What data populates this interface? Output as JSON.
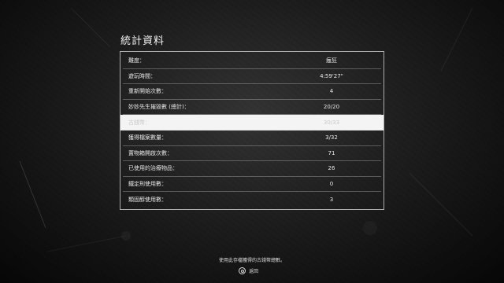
{
  "title": "統計資料",
  "stats": [
    {
      "label": "難度：",
      "value": "瘋狂"
    },
    {
      "label": "遊玩時間：",
      "value": "4:59'27\""
    },
    {
      "label": "重新開始次數：",
      "value": "4"
    },
    {
      "label": "妙妙先生摧毀數 (總計)：",
      "value": "20/20"
    },
    {
      "label": "古錢幣：",
      "value": "30/33"
    },
    {
      "label": "獲得檔案數量：",
      "value": "3/32"
    },
    {
      "label": "置物箱開啟次數：",
      "value": "71"
    },
    {
      "label": "已使用的治療物品：",
      "value": "26"
    },
    {
      "label": "鐵定刑使用數：",
      "value": "0"
    },
    {
      "label": "類固醇使用數：",
      "value": "3"
    }
  ],
  "selected_index": 4,
  "footer": {
    "hint": "使用此存檔獲得的古錢幣總數。",
    "back_label": "返回",
    "back_button_icon": "circle-button-icon"
  },
  "colors": {
    "background": "#1a1a1a",
    "text": "#e8e8e8",
    "selected_row_bg": "#f4f4f4",
    "selected_row_text": "#c9c9c9",
    "border": "#dcdcdc"
  }
}
